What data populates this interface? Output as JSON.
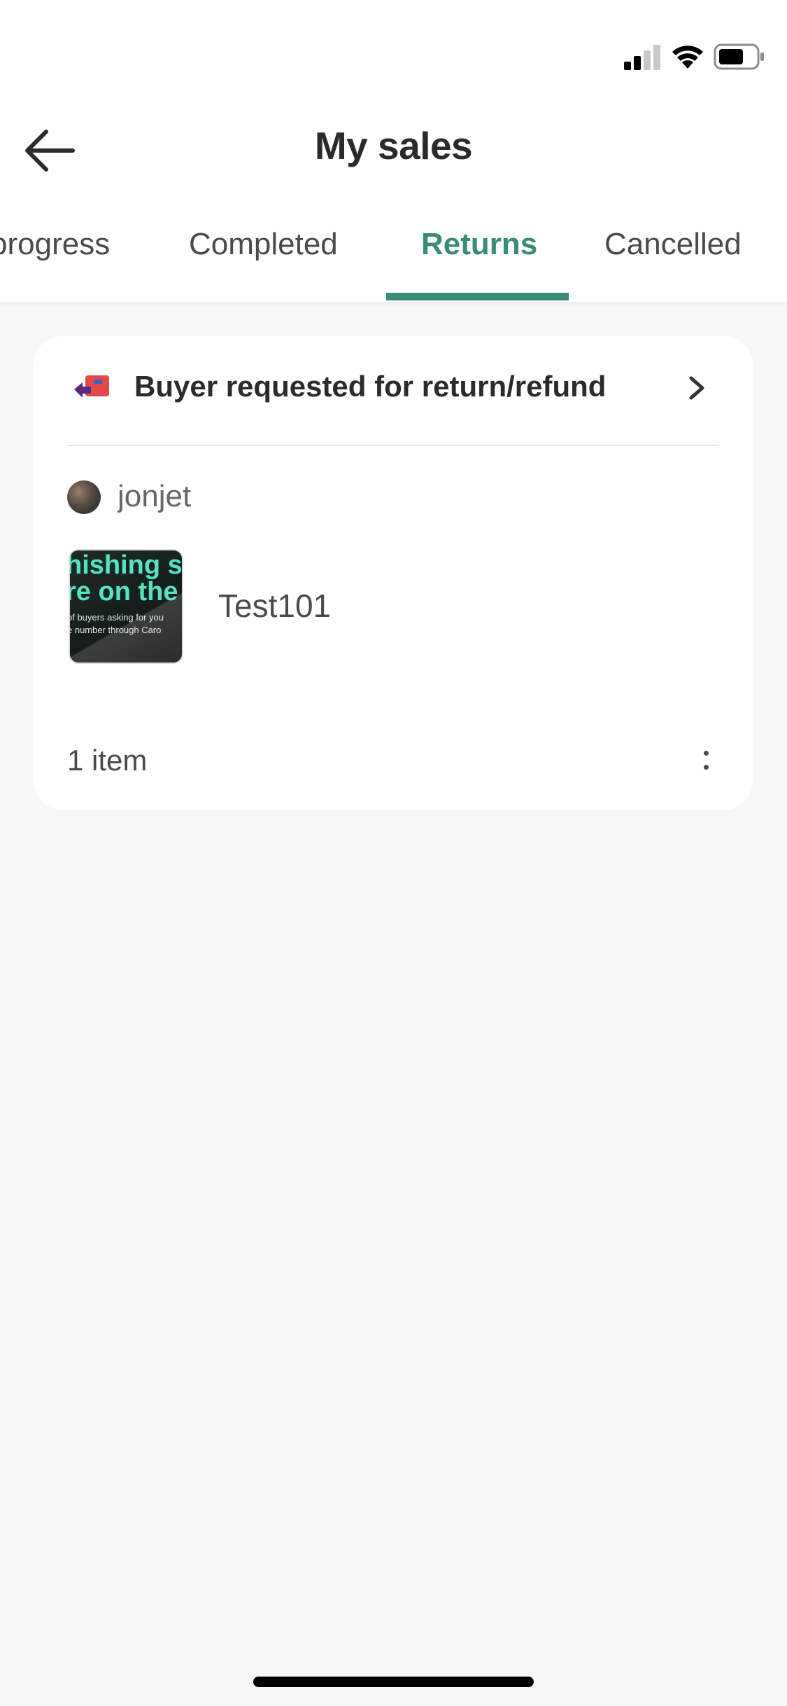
{
  "header": {
    "title": "My sales",
    "back_icon": "arrow-left-icon"
  },
  "tabs": [
    {
      "label": "progress",
      "active": false
    },
    {
      "label": "Completed",
      "active": false
    },
    {
      "label": "Returns",
      "active": true
    },
    {
      "label": "Cancelled",
      "active": false
    }
  ],
  "theme": {
    "accent": "#3a8c78",
    "background": "#f7f7f7",
    "card": "#ffffff"
  },
  "order": {
    "status_title": "Buyer requested for return/refund",
    "status_icon": "return-refund-icon",
    "username": "jonjet",
    "product": {
      "name": "Test101",
      "thumbnail_text": {
        "line1": "hishing s",
        "line2": "re on the",
        "line3": "of buyers asking for you",
        "line4": "e number through Caro"
      }
    },
    "item_count": "1 item",
    "more_icon": "more-vertical-icon"
  }
}
